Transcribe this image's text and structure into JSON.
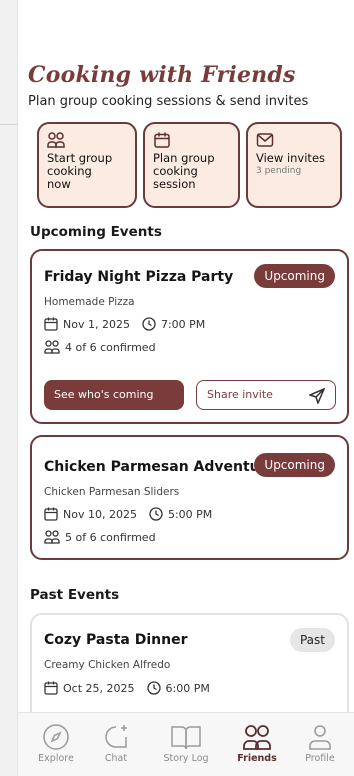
{
  "header": {
    "title": "Cooking with Friends",
    "subtitle": "Plan group cooking sessions & send invites"
  },
  "actions": [
    {
      "icon": "users-icon",
      "label_lines": [
        "Start group",
        "cooking",
        "now"
      ],
      "sub": ""
    },
    {
      "icon": "calendar-icon",
      "label_lines": [
        "Plan group",
        "cooking",
        "session"
      ],
      "sub": ""
    },
    {
      "icon": "mail-icon",
      "label_lines": [
        "View invites"
      ],
      "sub": "3 pending"
    }
  ],
  "sections": {
    "upcoming": "Upcoming Events",
    "past": "Past Events"
  },
  "upcoming_events": [
    {
      "title": "Friday Night Pizza Party",
      "dish": "Homemade Pizza",
      "date": "Nov 1, 2025",
      "time": "7:00 PM",
      "confirmed": "4 of 6 confirmed",
      "status": "Upcoming",
      "primary_action": "See who's coming",
      "secondary_action": "Share invite"
    },
    {
      "title": "Chicken Parmesan Adventure",
      "dish": "Chicken Parmesan Sliders",
      "date": "Nov 10, 2025",
      "time": "5:00 PM",
      "confirmed": "5 of 6 confirmed",
      "status": "Upcoming"
    }
  ],
  "past_events": [
    {
      "title": "Cozy Pasta Dinner",
      "dish": "Creamy Chicken Alfredo",
      "date": "Oct 25, 2025",
      "time": "6:00 PM",
      "status": "Past"
    }
  ],
  "tabs": [
    {
      "label": "Explore",
      "icon": "compass-icon",
      "active": false
    },
    {
      "label": "Chat",
      "icon": "chat-sparkle-icon",
      "active": false
    },
    {
      "label": "Story Log",
      "icon": "book-icon",
      "active": false
    },
    {
      "label": "Friends",
      "icon": "users-icon",
      "active": true
    },
    {
      "label": "Profile",
      "icon": "user-icon",
      "active": false
    }
  ],
  "colors": {
    "brand": "#7a3b3b",
    "card_fill": "#fbebe0",
    "badge_past": "#e6e6e6"
  }
}
